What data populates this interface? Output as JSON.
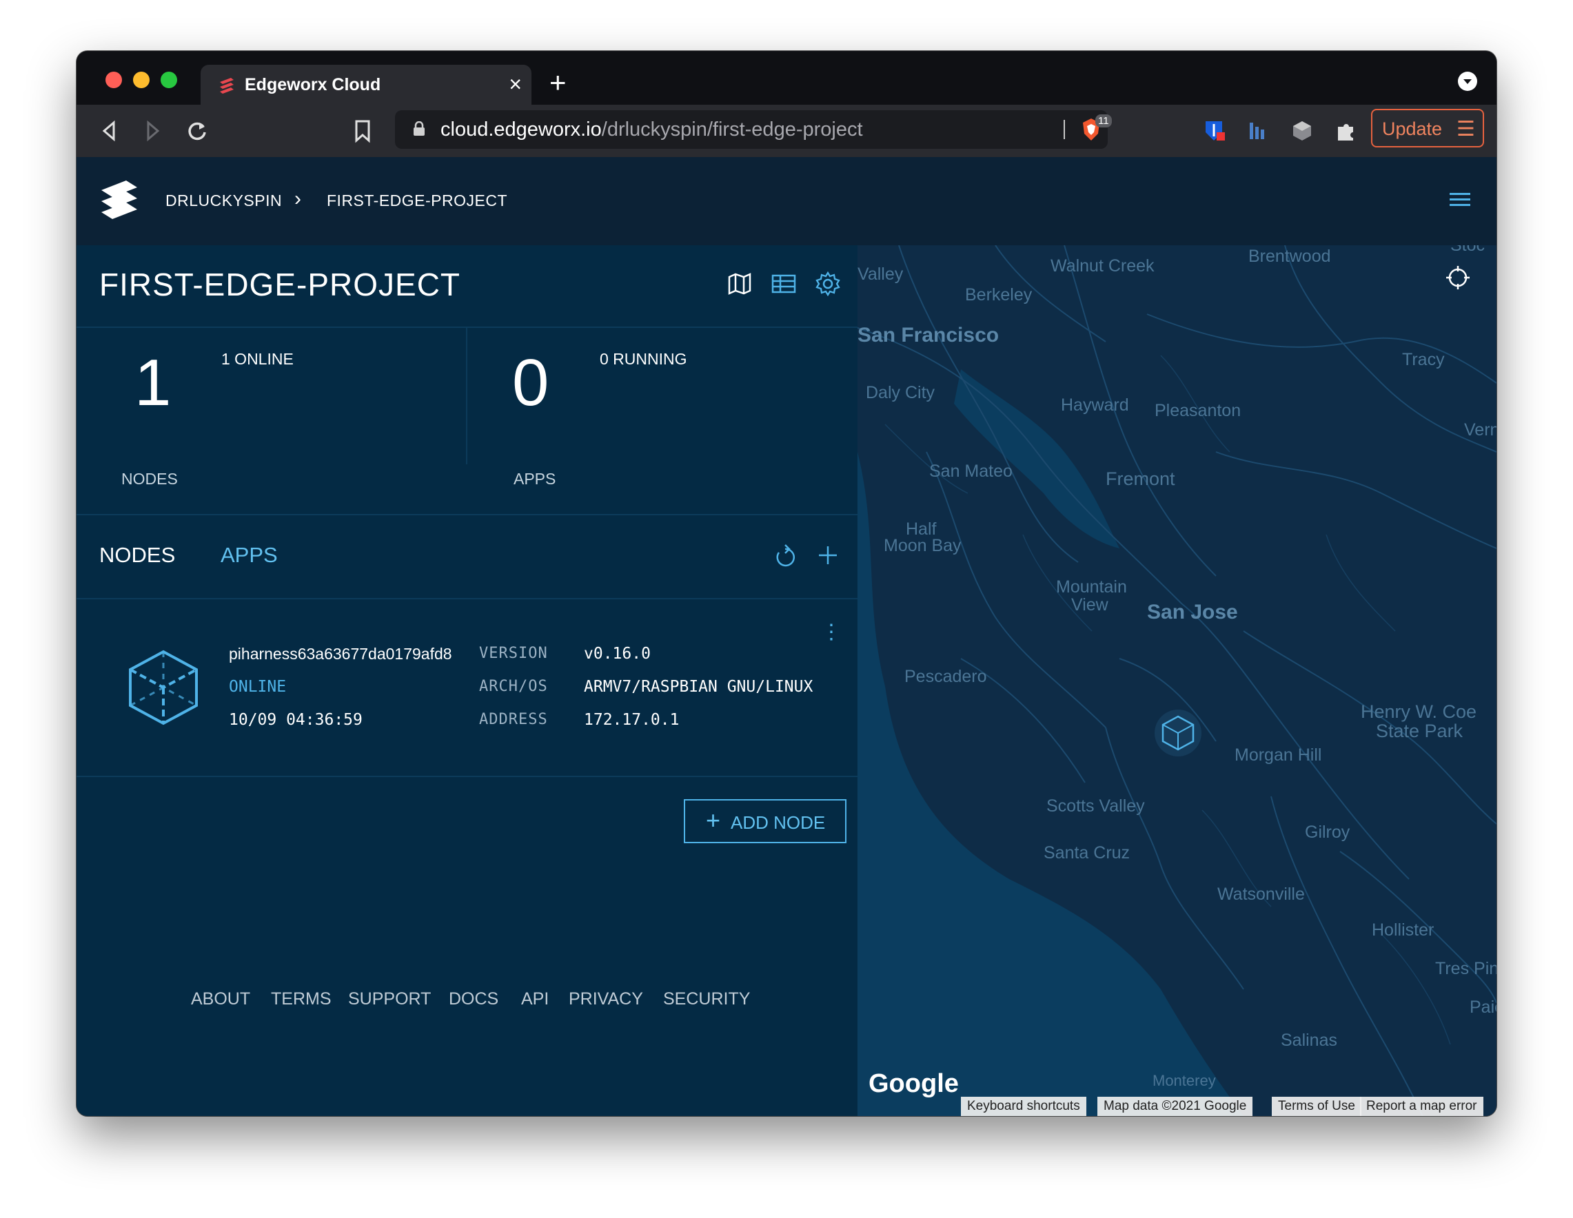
{
  "browser": {
    "tab_title": "Edgeworx Cloud",
    "tab_close": "×",
    "new_tab": "+",
    "url_domain": "cloud.edgeworx.io",
    "url_path": "/drluckyspin/first-edge-project",
    "brave_count": "11",
    "update_label": "Update",
    "update_menu": "☰"
  },
  "breadcrumb": {
    "org": "DRLUCKYSPIN",
    "separator": "›",
    "project": "FIRST-EDGE-PROJECT"
  },
  "project": {
    "title": "FIRST-EDGE-PROJECT"
  },
  "stats": {
    "nodes_count": "1",
    "nodes_label": "NODES",
    "nodes_online": "1 ONLINE",
    "apps_count": "0",
    "apps_label": "APPS",
    "apps_running": "0 RUNNING"
  },
  "tabs": {
    "nodes": "NODES",
    "apps": "APPS"
  },
  "node": {
    "name": "piharness63a63677da0179afd8",
    "status": "ONLINE",
    "last_seen": "10/09 04:36:59",
    "version_label": "VERSION",
    "version": "v0.16.0",
    "arch_label": "ARCH/OS",
    "arch": "ARMV7/RASPBIAN GNU/LINUX",
    "address_label": "ADDRESS",
    "address": "172.17.0.1",
    "menu": "⋮"
  },
  "actions": {
    "add_node": "ADD NODE",
    "add_node_icon": "+"
  },
  "footer": [
    "ABOUT",
    "TERMS",
    "SUPPORT",
    "DOCS",
    "API",
    "PRIVACY",
    "SECURITY"
  ],
  "map": {
    "labels": {
      "valley": "Valley",
      "walnut_creek": "Walnut Creek",
      "brentwood": "Brentwood",
      "berkeley": "Berkeley",
      "san_francisco": "San Francisco",
      "tracy": "Tracy",
      "daly_city": "Daly City",
      "hayward": "Hayward",
      "pleasanton": "Pleasanton",
      "vern": "Vern",
      "san_mateo": "San Mateo",
      "fremont": "Fremont",
      "half_moon_bay_1": "Half",
      "half_moon_bay_2": "Moon Bay",
      "mountain_view_1": "Mountain",
      "mountain_view_2": "View",
      "san_jose": "San Jose",
      "pescadero": "Pescadero",
      "henry_coe_1": "Henry W. Coe",
      "henry_coe_2": "State Park",
      "morgan_hill": "Morgan Hill",
      "scotts_valley": "Scotts Valley",
      "gilroy": "Gilroy",
      "santa_cruz": "Santa Cruz",
      "watsonville": "Watsonville",
      "hollister": "Hollister",
      "tres_pinos": "Tres Pin",
      "paicines": "Paic",
      "salinas": "Salinas",
      "monterey": "Monterey",
      "stoc": "Stoc"
    },
    "google_logo": "Google",
    "attribution": [
      "Keyboard shortcuts",
      "Map data ©2021 Google",
      "Terms of Use",
      "Report a map error"
    ]
  },
  "colors": {
    "accent": "#4fb3e8",
    "panel": "#042a44",
    "appbar": "#0c2236",
    "map": "#0e2c47",
    "update": "#e7623f"
  }
}
